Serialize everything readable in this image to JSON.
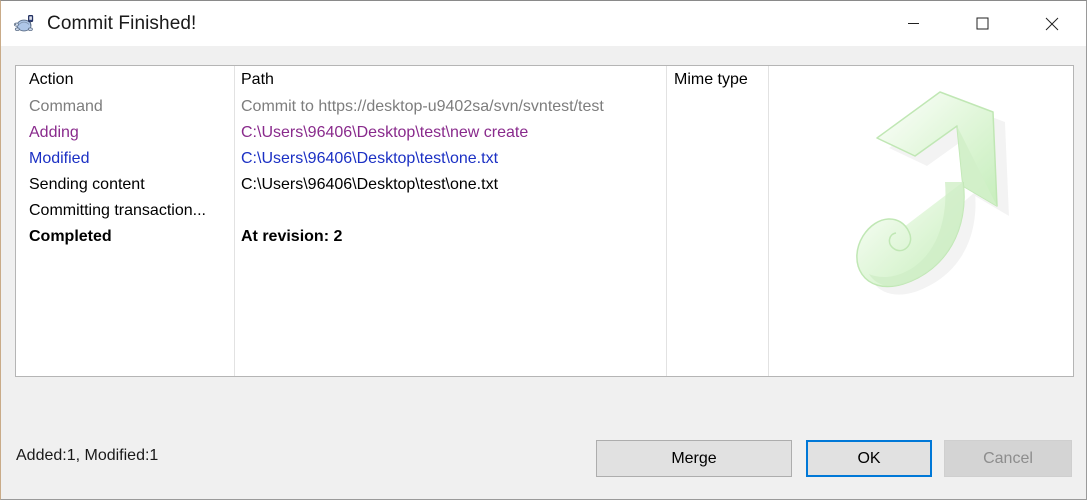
{
  "window": {
    "title": "Commit Finished!",
    "icon": "tortoisesvn-turtle-icon",
    "caption": {
      "minimize": "minimize-icon",
      "maximize": "maximize-icon",
      "close": "close-icon"
    }
  },
  "list": {
    "columns": [
      {
        "key": "action",
        "label": "Action"
      },
      {
        "key": "path",
        "label": "Path"
      },
      {
        "key": "mime",
        "label": "Mime type"
      }
    ],
    "rows": [
      {
        "action": "Command",
        "path": "Commit to https://desktop-u9402sa/svn/svntest/test",
        "mime": "",
        "style": "gray"
      },
      {
        "action": "Adding",
        "path": "C:\\Users\\96406\\Desktop\\test\\new create",
        "mime": "",
        "style": "purple"
      },
      {
        "action": "Modified",
        "path": "C:\\Users\\96406\\Desktop\\test\\one.txt",
        "mime": "",
        "style": "blue"
      },
      {
        "action": "Sending content",
        "path": "C:\\Users\\96406\\Desktop\\test\\one.txt",
        "mime": "",
        "style": "normal"
      },
      {
        "action": "Committing transaction...",
        "path": "",
        "mime": "",
        "style": "normal"
      },
      {
        "action": "Completed",
        "path": "At revision: 2",
        "mime": "",
        "style": "bold"
      }
    ]
  },
  "watermark": {
    "icon": "green-curved-commit-arrow-icon",
    "color": "#d8f5d2"
  },
  "footer": {
    "status": "Added:1, Modified:1",
    "buttons": {
      "merge": "Merge",
      "ok": "OK",
      "cancel": "Cancel"
    }
  },
  "colors": {
    "accent": "#0078d7",
    "added": "#892a8c",
    "modified": "#1b30c4",
    "command": "#7d7d7d",
    "dialog_bg": "#f0f0f0"
  }
}
